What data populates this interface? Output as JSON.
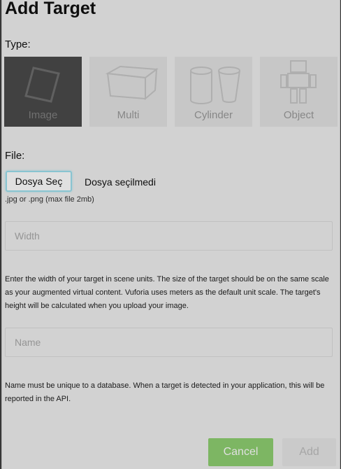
{
  "dialog": {
    "title": "Add Target",
    "type_label": "Type:",
    "types": [
      {
        "label": "Image",
        "icon": "image-icon",
        "selected": true
      },
      {
        "label": "Multi",
        "icon": "box-icon",
        "selected": false
      },
      {
        "label": "Cylinder",
        "icon": "cylinder-icon",
        "selected": false
      },
      {
        "label": "Object",
        "icon": "robot-icon",
        "selected": false
      }
    ],
    "file_label": "File:",
    "file_button": "Dosya Seç",
    "file_status": "Dosya seçilmedi",
    "file_hint": ".jpg or .png (max file 2mb)",
    "width_placeholder": "Width",
    "width_help": "Enter the width of your target in scene units. The size of the target should be on the same scale as your augmented virtual content. Vuforia uses meters as the default unit scale. The target's height will be calculated when you upload your image.",
    "name_placeholder": "Name",
    "name_help": "Name must be unique to a database. When a target is detected in your application, this will be reported in the API.",
    "cancel_label": "Cancel",
    "add_label": "Add"
  },
  "colors": {
    "cancel_button": "#8fd071",
    "selected_tile": "#4b4b4b",
    "focus_ring": "#9de0ee"
  }
}
